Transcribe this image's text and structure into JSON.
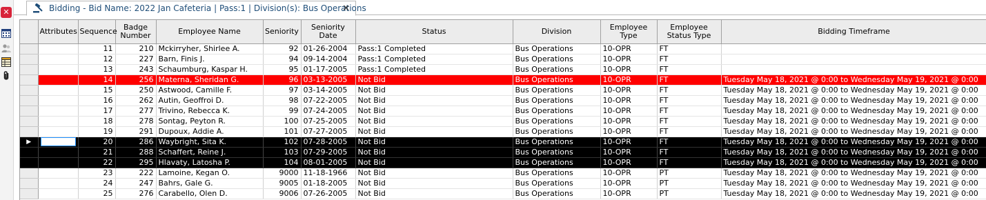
{
  "tab": {
    "title": "Bidding - Bid Name: 2022 Jan Cafeteria | Pass:1 | Division(s): Bus Operations",
    "close_label": "✕"
  },
  "toolbar": {
    "close_label": "✕"
  },
  "colors": {
    "highlight_red": "#ff0000",
    "selection_black": "#000000",
    "tab_text": "#1f4e79"
  },
  "columns": [
    "Attributes",
    "Sequence",
    "Badge Number",
    "Employee Name",
    "Seniority",
    "Seniority Date",
    "Status",
    "Division",
    "Employee Type",
    "Employee Status Type",
    "Bidding Timeframe"
  ],
  "rows": [
    {
      "attributes": "",
      "sequence": "11",
      "badge": "210",
      "name": "Mckirryher, Shirlee A.",
      "seniority": "92",
      "seniority_date": "01-26-2004",
      "status": "Pass:1 Completed",
      "division": "Bus Operations",
      "emp_type": "10-OPR",
      "emp_status": "FT",
      "timeframe": ""
    },
    {
      "attributes": "",
      "sequence": "12",
      "badge": "227",
      "name": "Barn, Finis J.",
      "seniority": "94",
      "seniority_date": "09-14-2004",
      "status": "Pass:1 Completed",
      "division": "Bus Operations",
      "emp_type": "10-OPR",
      "emp_status": "FT",
      "timeframe": ""
    },
    {
      "attributes": "",
      "sequence": "13",
      "badge": "243",
      "name": "Schaumburg, Kaspar H.",
      "seniority": "95",
      "seniority_date": "01-17-2005",
      "status": "Pass:1 Completed",
      "division": "Bus Operations",
      "emp_type": "10-OPR",
      "emp_status": "FT",
      "timeframe": ""
    },
    {
      "attributes": "",
      "sequence": "14",
      "badge": "256",
      "name": "Materna, Sheridan G.",
      "seniority": "96",
      "seniority_date": "03-13-2005",
      "status": "Not Bid",
      "division": "Bus Operations",
      "emp_type": "10-OPR",
      "emp_status": "FT",
      "timeframe": "Tuesday May 18, 2021 @ 0:00 to Wednesday May 19, 2021 @ 0:00",
      "highlight": "red"
    },
    {
      "attributes": "",
      "sequence": "15",
      "badge": "250",
      "name": "Astwood, Camille F.",
      "seniority": "97",
      "seniority_date": "03-14-2005",
      "status": "Not Bid",
      "division": "Bus Operations",
      "emp_type": "10-OPR",
      "emp_status": "FT",
      "timeframe": "Tuesday May 18, 2021 @ 0:00 to Wednesday May 19, 2021 @ 0:00"
    },
    {
      "attributes": "",
      "sequence": "16",
      "badge": "262",
      "name": "Autin, Geoffroi D.",
      "seniority": "98",
      "seniority_date": "07-22-2005",
      "status": "Not Bid",
      "division": "Bus Operations",
      "emp_type": "10-OPR",
      "emp_status": "FT",
      "timeframe": "Tuesday May 18, 2021 @ 0:00 to Wednesday May 19, 2021 @ 0:00"
    },
    {
      "attributes": "",
      "sequence": "17",
      "badge": "277",
      "name": "Trivino, Rebecca K.",
      "seniority": "99",
      "seniority_date": "07-24-2005",
      "status": "Not Bid",
      "division": "Bus Operations",
      "emp_type": "10-OPR",
      "emp_status": "FT",
      "timeframe": "Tuesday May 18, 2021 @ 0:00 to Wednesday May 19, 2021 @ 0:00"
    },
    {
      "attributes": "",
      "sequence": "18",
      "badge": "278",
      "name": "Sontag, Peyton R.",
      "seniority": "100",
      "seniority_date": "07-25-2005",
      "status": "Not Bid",
      "division": "Bus Operations",
      "emp_type": "10-OPR",
      "emp_status": "FT",
      "timeframe": "Tuesday May 18, 2021 @ 0:00 to Wednesday May 19, 2021 @ 0:00"
    },
    {
      "attributes": "",
      "sequence": "19",
      "badge": "291",
      "name": "Dupoux, Addie A.",
      "seniority": "101",
      "seniority_date": "07-27-2005",
      "status": "Not Bid",
      "division": "Bus Operations",
      "emp_type": "10-OPR",
      "emp_status": "FT",
      "timeframe": "Tuesday May 18, 2021 @ 0:00 to Wednesday May 19, 2021 @ 0:00"
    },
    {
      "attributes": "",
      "sequence": "20",
      "badge": "286",
      "name": "Waybright, Sita K.",
      "seniority": "102",
      "seniority_date": "07-28-2005",
      "status": "Not Bid",
      "division": "Bus Operations",
      "emp_type": "10-OPR",
      "emp_status": "FT",
      "timeframe": "Tuesday May 18, 2021 @ 0:00 to Wednesday May 19, 2021 @ 0:00",
      "highlight": "black",
      "current": true
    },
    {
      "attributes": "",
      "sequence": "21",
      "badge": "288",
      "name": "Schaffert, Reine J.",
      "seniority": "103",
      "seniority_date": "07-29-2005",
      "status": "Not Bid",
      "division": "Bus Operations",
      "emp_type": "10-OPR",
      "emp_status": "FT",
      "timeframe": "Tuesday May 18, 2021 @ 0:00 to Wednesday May 19, 2021 @ 0:00",
      "highlight": "black"
    },
    {
      "attributes": "",
      "sequence": "22",
      "badge": "295",
      "name": "Hlavaty, Latosha P.",
      "seniority": "104",
      "seniority_date": "08-01-2005",
      "status": "Not Bid",
      "division": "Bus Operations",
      "emp_type": "10-OPR",
      "emp_status": "FT",
      "timeframe": "Tuesday May 18, 2021 @ 0:00 to Wednesday May 19, 2021 @ 0:00",
      "highlight": "black"
    },
    {
      "attributes": "",
      "sequence": "23",
      "badge": "222",
      "name": "Lamoine, Kegan O.",
      "seniority": "9000",
      "seniority_date": "11-18-1966",
      "status": "Not Bid",
      "division": "Bus Operations",
      "emp_type": "10-OPR",
      "emp_status": "PT",
      "timeframe": "Tuesday May 18, 2021 @ 0:00 to Wednesday May 19, 2021 @ 0:00"
    },
    {
      "attributes": "",
      "sequence": "24",
      "badge": "247",
      "name": "Bahrs, Gale G.",
      "seniority": "9005",
      "seniority_date": "01-18-2005",
      "status": "Not Bid",
      "division": "Bus Operations",
      "emp_type": "10-OPR",
      "emp_status": "PT",
      "timeframe": "Tuesday May 18, 2021 @ 0:00 to Wednesday May 19, 2021 @ 0:00"
    },
    {
      "attributes": "",
      "sequence": "25",
      "badge": "276",
      "name": "Carabello, Olen D.",
      "seniority": "9006",
      "seniority_date": "07-26-2005",
      "status": "Not Bid",
      "division": "Bus Operations",
      "emp_type": "10-OPR",
      "emp_status": "PT",
      "timeframe": "Tuesday May 18, 2021 @ 0:00 to Wednesday May 19, 2021 @ 0:00"
    }
  ]
}
